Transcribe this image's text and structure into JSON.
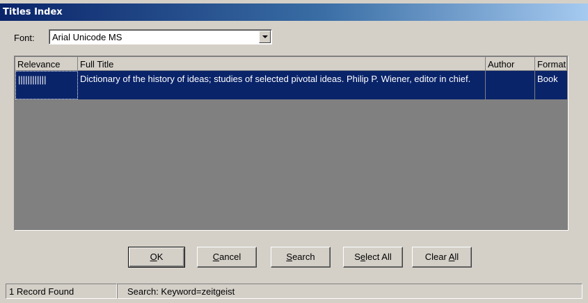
{
  "window": {
    "title": "Titles Index"
  },
  "font": {
    "label": "Font:",
    "value": "Arial Unicode MS"
  },
  "table": {
    "columns": [
      "Relevance",
      "Full Title",
      "Author",
      "Format"
    ],
    "rows": [
      {
        "relevance": "||||||||||||",
        "full_title": "Dictionary of the history of ideas; studies of selected pivotal ideas. Philip P. Wiener, editor in chief.",
        "author": "",
        "format": "Book"
      }
    ]
  },
  "buttons": {
    "ok": {
      "pre": "",
      "mnemonic": "O",
      "post": "K"
    },
    "cancel": {
      "pre": "",
      "mnemonic": "C",
      "post": "ancel"
    },
    "search": {
      "pre": "",
      "mnemonic": "S",
      "post": "earch"
    },
    "select_all": {
      "pre": "S",
      "mnemonic": "e",
      "post": "lect All"
    },
    "clear_all": {
      "pre": "Clear ",
      "mnemonic": "A",
      "post": "ll"
    }
  },
  "status": {
    "records": "1 Record Found",
    "search": "Search: Keyword=zeitgeist"
  }
}
